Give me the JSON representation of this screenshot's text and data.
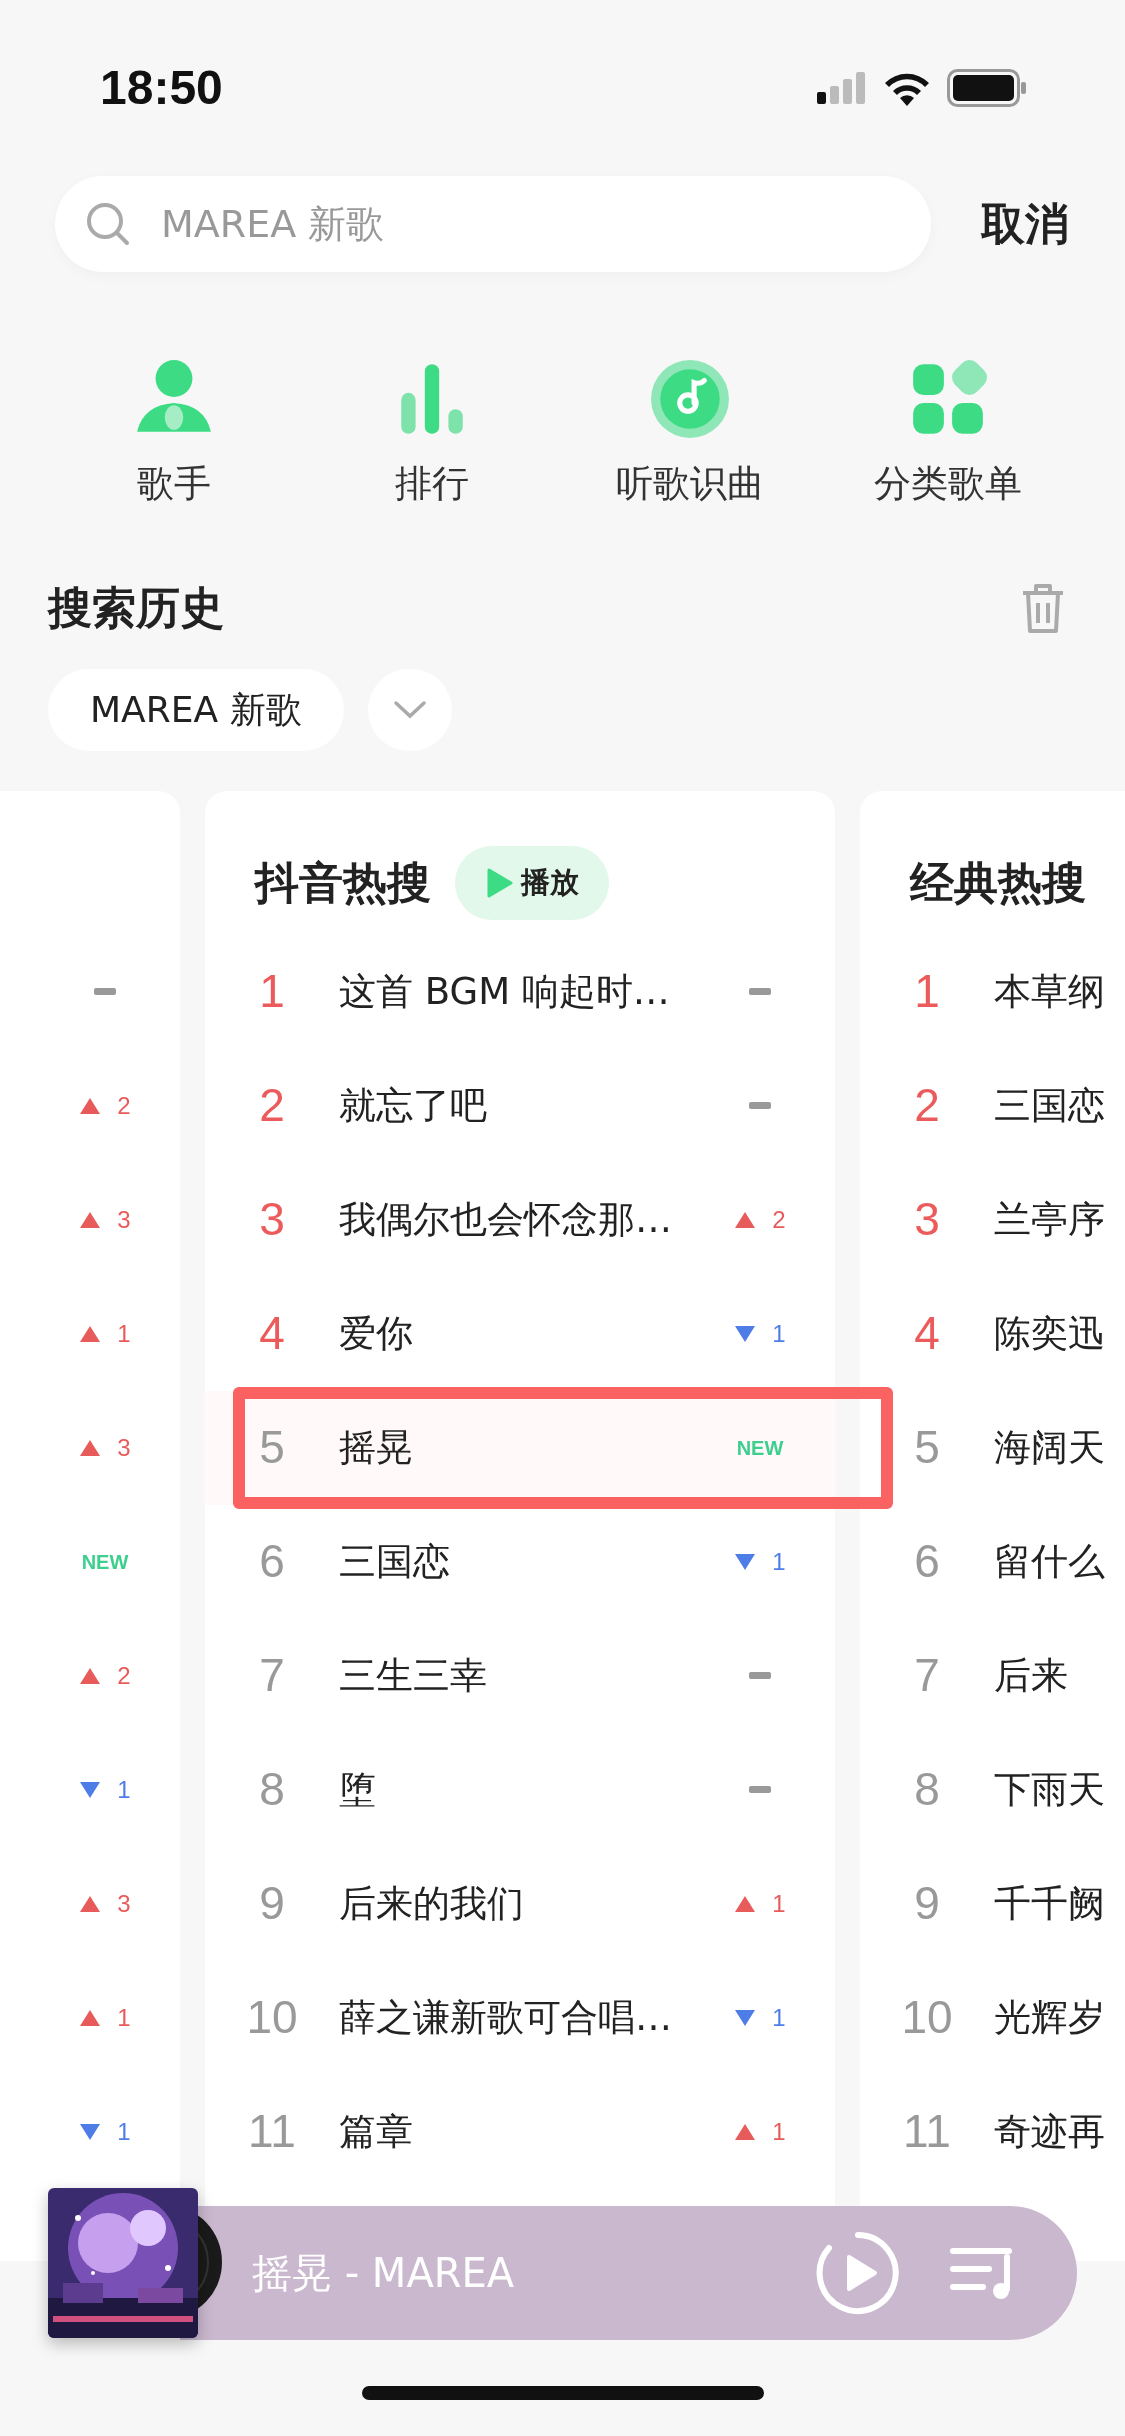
{
  "status_bar": {
    "time": "18:50"
  },
  "search": {
    "placeholder": "MAREA 新歌",
    "cancel": "取消"
  },
  "shortcuts": [
    {
      "kind": "singer",
      "label": "歌手"
    },
    {
      "kind": "rank",
      "label": "排行"
    },
    {
      "kind": "recognize",
      "label": "听歌识曲"
    },
    {
      "kind": "category",
      "label": "分类歌单"
    }
  ],
  "history": {
    "title": "搜索历史",
    "items": [
      "MAREA 新歌"
    ]
  },
  "charts": [
    {
      "rows": [
        {
          "trend": {
            "kind": "same"
          }
        },
        {
          "trend": {
            "kind": "up",
            "value": "2"
          }
        },
        {
          "trend": {
            "kind": "up",
            "value": "3"
          }
        },
        {
          "trend": {
            "kind": "up",
            "value": "1"
          }
        },
        {
          "trend": {
            "kind": "up",
            "value": "3"
          }
        },
        {
          "trend": {
            "kind": "new",
            "value": "NEW"
          }
        },
        {
          "trend": {
            "kind": "up",
            "value": "2"
          }
        },
        {
          "trend": {
            "kind": "down",
            "value": "1"
          }
        },
        {
          "trend": {
            "kind": "up",
            "value": "3"
          }
        },
        {
          "trend": {
            "kind": "up",
            "value": "1"
          }
        },
        {
          "trend": {
            "kind": "down",
            "value": "1"
          }
        }
      ]
    },
    {
      "title": "抖音热搜",
      "play_label": "播放",
      "rows": [
        {
          "rank": "1",
          "hot": true,
          "title": "这首 BGM 响起时…",
          "highlighted": false,
          "trend": {
            "kind": "same"
          }
        },
        {
          "rank": "2",
          "hot": true,
          "title": "就忘了吧",
          "highlighted": false,
          "trend": {
            "kind": "same"
          }
        },
        {
          "rank": "3",
          "hot": true,
          "title": "我偶尔也会怀念那…",
          "highlighted": false,
          "trend": {
            "kind": "up",
            "value": "2"
          }
        },
        {
          "rank": "4",
          "hot": true,
          "title": "爱你",
          "highlighted": false,
          "trend": {
            "kind": "down",
            "value": "1"
          }
        },
        {
          "rank": "5",
          "hot": false,
          "title": "摇晃",
          "highlighted": true,
          "trend": {
            "kind": "new",
            "value": "NEW"
          }
        },
        {
          "rank": "6",
          "hot": false,
          "title": "三国恋",
          "highlighted": false,
          "trend": {
            "kind": "down",
            "value": "1"
          }
        },
        {
          "rank": "7",
          "hot": false,
          "title": "三生三幸",
          "highlighted": false,
          "trend": {
            "kind": "same"
          }
        },
        {
          "rank": "8",
          "hot": false,
          "title": "堕",
          "highlighted": false,
          "trend": {
            "kind": "same"
          }
        },
        {
          "rank": "9",
          "hot": false,
          "title": "后来的我们",
          "highlighted": false,
          "trend": {
            "kind": "up",
            "value": "1"
          }
        },
        {
          "rank": "10",
          "hot": false,
          "title": "薛之谦新歌可合唱…",
          "highlighted": false,
          "trend": {
            "kind": "down",
            "value": "1"
          }
        },
        {
          "rank": "11",
          "hot": false,
          "title": "篇章",
          "highlighted": false,
          "trend": {
            "kind": "up",
            "value": "1"
          }
        }
      ]
    },
    {
      "title": "经典热搜",
      "rows": [
        {
          "rank": "1",
          "hot": true,
          "title": "本草纲"
        },
        {
          "rank": "2",
          "hot": true,
          "title": "三国恋"
        },
        {
          "rank": "3",
          "hot": true,
          "title": "兰亭序"
        },
        {
          "rank": "4",
          "hot": true,
          "title": "陈奕迅"
        },
        {
          "rank": "5",
          "hot": false,
          "title": "海阔天"
        },
        {
          "rank": "6",
          "hot": false,
          "title": "留什么"
        },
        {
          "rank": "7",
          "hot": false,
          "title": "后来"
        },
        {
          "rank": "8",
          "hot": false,
          "title": "下雨天"
        },
        {
          "rank": "9",
          "hot": false,
          "title": "千千阙"
        },
        {
          "rank": "10",
          "hot": false,
          "title": "光辉岁"
        },
        {
          "rank": "11",
          "hot": false,
          "title": "奇迹再"
        }
      ]
    }
  ],
  "player": {
    "now_playing": "摇晃 - MAREA"
  }
}
